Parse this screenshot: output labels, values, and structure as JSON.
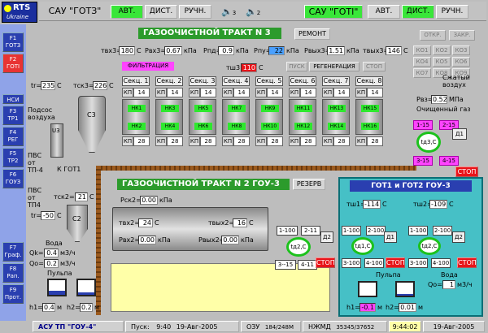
{
  "logo": {
    "brand": "RTS",
    "sub": "Ukraine"
  },
  "top": {
    "sau1": "САУ \"ГОТЗ\"",
    "mode1": [
      "АВТ.",
      "ДИСТ.",
      "РУЧН."
    ],
    "sau2": "САУ \"ГОТІ\"",
    "mode2": [
      "АВТ.",
      "ДИСТ.",
      "РУЧН."
    ],
    "sound": [
      "3",
      "2"
    ]
  },
  "sidebar": [
    {
      "key": "F1",
      "label": "ГОТЗ"
    },
    {
      "key": "F2",
      "label": "ГОТІ"
    },
    {
      "key": "",
      "label": "НСИ"
    },
    {
      "key": "F3",
      "label": "ТР1"
    },
    {
      "key": "F4",
      "label": "РЕГ"
    },
    {
      "key": "F5",
      "label": "ТР2"
    },
    {
      "key": "F6",
      "label": "ГОУЗ"
    },
    {
      "key": "F7",
      "label": "Граф."
    },
    {
      "key": "F8",
      "label": "Рап."
    },
    {
      "key": "F9",
      "label": "Прот."
    }
  ],
  "tract3": {
    "title": "ГАЗООЧИСТНОЙ ТРАКТ N 3",
    "remont": "РЕМОНТ",
    "otkr": "ОТКР.",
    "zakr": "ЗАКР.",
    "twh3": "твх3=",
    "twh3_val": "180",
    "twh3_unit": "С",
    "pwh3": "Рвх3=",
    "pwh3_val": "0.67",
    "pwh3_unit": "кПа",
    "rpd": "Рпд=",
    "rpd_val": "0.9",
    "rpd_unit": "кПа",
    "rpu": "Рпу=",
    "rpu_val": "22",
    "rpu_unit": "кПа",
    "pvyh3": "Рвых3=",
    "pvyh3_val": "1.51",
    "pvyh3_unit": "кПа",
    "tvyh3": "твых3=",
    "tvyh3_val": "146",
    "tvyh3_unit": "С",
    "filtr": "ФИЛЬТРАЦИЯ",
    "tsh3": "тш3=",
    "tsh3_val": "110",
    "tsh3_unit": "С",
    "pusk": "ПУСК",
    "regen": "РЕГЕНЕРАЦИЯ",
    "stop": "СТОП",
    "ko": [
      "КО1",
      "КО2",
      "КО3",
      "КО4",
      "КО5",
      "КО6",
      "КО7",
      "КО8",
      "КО9"
    ],
    "tr": "tr=",
    "tr_val": "235",
    "tr_unit": "С",
    "tsk3": "тск3=",
    "tsk3_val": "226",
    "tsk3_unit": "С",
    "podsos": "Подсос воздуха",
    "s3": "С3",
    "u3": "U3",
    "pvs": "ПВС от ТП-4",
    "kgot1": "К ГОТ1",
    "szhat": "Сжатый воздух",
    "rvz": "Рвз=",
    "rvz_val": "0.52",
    "rvz_unit": "МПа",
    "ochish": "Очищенный газ",
    "d1": "Д1",
    "tdc": "tд3,С",
    "pmin": [
      "1-15",
      "2-15",
      "3-15",
      "4-15"
    ],
    "stop2": "СТОП",
    "sections": [
      {
        "name": "Секц. 1",
        "kp": "14",
        "a": "НК1",
        "b": "НК2",
        "n": "28"
      },
      {
        "name": "Секц. 2",
        "kp": "14",
        "a": "НК3",
        "b": "НК4",
        "n": "28"
      },
      {
        "name": "Секц. 3",
        "kp": "14",
        "a": "НК5",
        "b": "НК6",
        "n": "28"
      },
      {
        "name": "Секц. 4",
        "kp": "14",
        "a": "НК7",
        "b": "НК8",
        "n": "28"
      },
      {
        "name": "Секц. 5",
        "kp": "14",
        "a": "НК9",
        "b": "НК10",
        "n": "28"
      },
      {
        "name": "Секц. 6",
        "kp": "14",
        "a": "НК11",
        "b": "НК12",
        "n": "28"
      },
      {
        "name": "Секц. 7",
        "kp": "14",
        "a": "НК13",
        "b": "НК14",
        "n": "28"
      },
      {
        "name": "Секц. 8",
        "kp": "14",
        "a": "НК15",
        "b": "НК16",
        "n": "28"
      }
    ],
    "kp": "КП"
  },
  "tract2": {
    "title": "ГАЗООЧИСТНОЙ ТРАКТ N 2 ГОУ-3",
    "rezerv": "РЕЗЕРВ",
    "rsk2": "Рск2=",
    "rsk2_val": "0.00",
    "rsk2_unit": "кПа",
    "twh2": "твх2=",
    "twh2_val": "24",
    "twh2_unit": "С",
    "tvyh2": "твых2=",
    "tvyh2_val": "16",
    "tvyh2_unit": "С",
    "rvh2": "Рвх2=",
    "rvh2_val": "0.00",
    "rvh2_unit": "кПа",
    "rvyh2": "Рвых2=",
    "rvyh2_val": "0.00",
    "rvyh2_unit": "кПа",
    "tsk2": "тск2=",
    "tsk2_val": "21",
    "tsk2_unit": "С",
    "tr": "tr=",
    "tr_val": "-50",
    "tr_unit": "С",
    "pvs": "ПВС от ТП4",
    "c2": "С2",
    "d2": "Д2",
    "tdc": "tд2,С",
    "p": [
      "1-100",
      "2-11",
      "3--15",
      "4-11"
    ],
    "stop": "СТОП",
    "voda": "Вода",
    "qk": "Qk=",
    "qk_val": "0.4",
    "qk_unit": "м3/ч",
    "qo": "Qo=",
    "qo_val": "0.2",
    "qo_unit": "м3/ч",
    "pulpa": "Пульпа",
    "h1": "h1=",
    "h1_val": "0.4",
    "h1_unit": "м",
    "h2": "h2=",
    "h2_val": "0.2",
    "h2_unit": "м"
  },
  "gou3": {
    "title": "ГОТ1 и ГОТ2 ГОУ-3",
    "tsh1": "тш1=",
    "tsh1_val": "-114",
    "tsh1_unit": "С",
    "tsh2": "тш2=",
    "tsh2_val": "-109",
    "tsh2_unit": "С",
    "l": [
      "1-100",
      "2-100",
      "3-100",
      "4-100"
    ],
    "r": [
      "1-100",
      "2-100",
      "3-100",
      "4-100"
    ],
    "td1": "tд1,С",
    "td2": "tд2,С",
    "d1": "Д1",
    "d2": "Д2",
    "stop": "СТОП",
    "voda": "Вода",
    "qo": "Qo=",
    "qo_val": "1",
    "qo_unit": "м3/ч",
    "pulpa": "Пульпа",
    "h1": "h1=",
    "h1_val": "-0.1",
    "h1_unit": "м",
    "h2": "h2=",
    "h2_val": "0.01",
    "h2_unit": "м"
  },
  "status": {
    "sys": "АСУ ТП \"ГОУ-4\"",
    "pusk": "Пуск:",
    "time": "9:40",
    "date": "19-Авг-2005",
    "ozu": "ОЗУ",
    "ozu_val": "184/248M",
    "nzhmd": "НЖМД",
    "nzhmd_val": "35345/37652",
    "clock": "9:44:02",
    "date2": "19-Авг-2005"
  }
}
